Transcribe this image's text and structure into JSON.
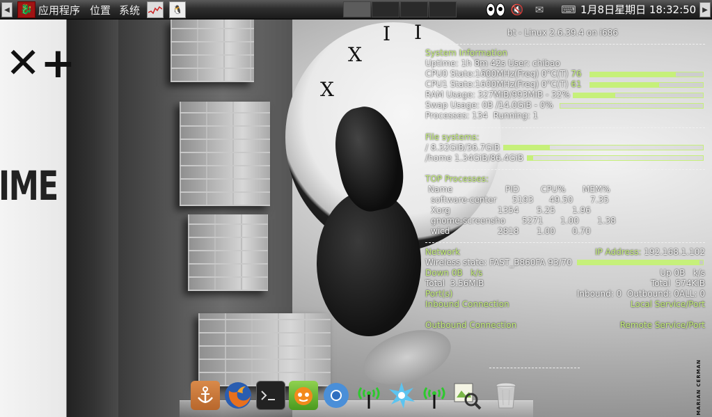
{
  "top_panel": {
    "left_arrow": "◀",
    "right_arrow": "▶",
    "menu_applications": "应用程序",
    "menu_places": "位置",
    "menu_system": "系统",
    "datetime": "1月8日星期日 18:32:50"
  },
  "conky": {
    "header": "bt - Linux 2.6.39.4 on i686",
    "system": {
      "title": "System Information",
      "uptime_label": "Uptime:",
      "uptime_value": "1h 8m 42s",
      "user_label": "User:",
      "user_value": "chibao",
      "cpu0_label": "CPU0 State:",
      "cpu0_value": "1600MHz(Freq) 0°C(T)",
      "cpu0_percent": "76",
      "cpu0_level": 0.76,
      "cpu1_label": "CPU1 State:",
      "cpu1_value": "1600MHz(Freq) 0°C(T)",
      "cpu1_percent": "61",
      "cpu1_level": 0.61,
      "ram_label": "RAM Usage:",
      "ram_value": "327MiB/993MiB - 32%",
      "ram_level": 0.32,
      "swap_label": "Swap Usage:",
      "swap_value": "0B /14.0GiB - 0%",
      "swap_level": 0.0,
      "procs_label": "Processes:",
      "procs_value": "134",
      "running_label": "Running:",
      "running_value": "1"
    },
    "filesystems": {
      "title": "File systems:",
      "root": "/ 8.32GiB/36.7GiB",
      "root_level": 0.23,
      "home": "/home 1.34GiB/86.4GiB",
      "home_level": 0.03
    },
    "processes": {
      "title": "TOP Processes:",
      "headers": [
        "Name",
        "PID",
        "CPU%",
        "MEM%"
      ],
      "rows": [
        {
          "name": "software-center",
          "pid": "5193",
          "cpu": "49.50",
          "mem": "7.35"
        },
        {
          "name": "Xorg",
          "pid": "1354",
          "cpu": "5.25",
          "mem": "1.96"
        },
        {
          "name": "gnome-screensho",
          "pid": "5271",
          "cpu": "1.00",
          "mem": "1.38"
        },
        {
          "name": "wicd",
          "pid": "2818",
          "cpu": "1.00",
          "mem": "0.70"
        }
      ]
    },
    "network": {
      "title": "Network",
      "ip_label": "IP Address:",
      "ip_value": "192.168.1.102",
      "wireless_label": "Wireless state:",
      "wireless_value": "FAST_B860FA 93/70",
      "wireless_level": 0.97,
      "down": "Down 0B   k/s",
      "up": "Up 0B   k/s",
      "total_down": "Total  3.56MiB",
      "total_up": "Total  574KiB",
      "ports_label": "Port(s)",
      "ports_value": "Inbound: 0  Outbound: 0ALL: 0",
      "inbound_label": "Inbound Connection",
      "local_port_label": "Local Service/Port",
      "outbound_label": "Outbound Connection",
      "remote_port_label": "Remote Service/Port"
    }
  },
  "wallpaper": {
    "signature": "MARIAN CERMAN"
  },
  "colors": {
    "conky_accent": "#c6f07a",
    "panel": "#2e2e2e"
  },
  "dock": {
    "items": [
      "anchor-icon",
      "firefox-icon",
      "terminal-icon",
      "chat-icon",
      "chromium-icon",
      "wifi-icon",
      "network-burst-icon",
      "wifi-icon",
      "image-viewer-icon",
      "trash-icon"
    ]
  }
}
